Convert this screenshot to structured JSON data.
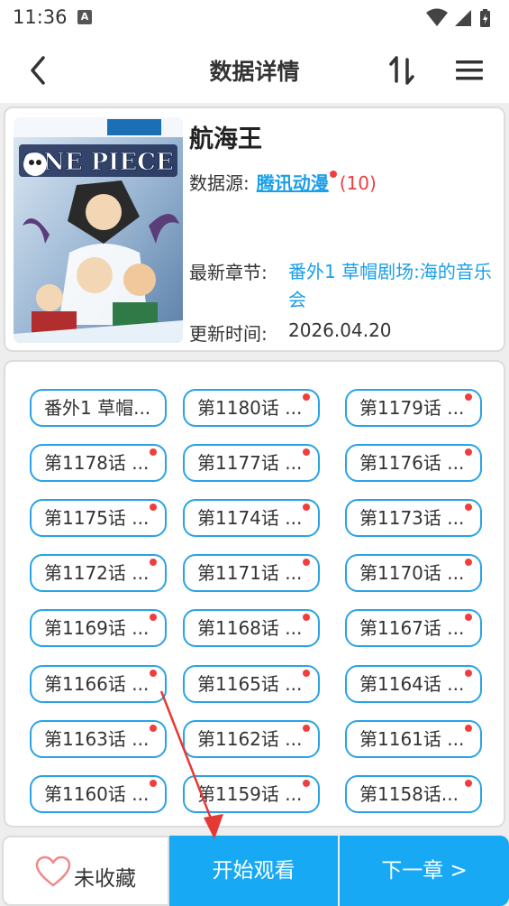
{
  "status_bar": {
    "time": "11:36",
    "notification_badge": "A",
    "icons": [
      "wifi-icon",
      "cell-signal-icon",
      "battery-icon"
    ]
  },
  "app_bar": {
    "title": "数据详情",
    "icons": [
      "back-arrow-icon",
      "sort-swap-icon",
      "menu-icon"
    ]
  },
  "comic": {
    "title": "航海王",
    "source_label": "数据源:",
    "source_name": "腾讯动漫",
    "source_count": "(10)",
    "latest_label": "最新章节:",
    "latest_value": "番外1 草帽剧场:海的音乐会",
    "update_label": "更新时间:",
    "update_value": "2026.04.20",
    "cover_art_text": "ONE PIECE"
  },
  "chapters": [
    {
      "label": "番外1 草帽...",
      "new": false
    },
    {
      "label": "第1180话 ...",
      "new": true
    },
    {
      "label": "第1179话 ...",
      "new": true
    },
    {
      "label": "第1178话 ...",
      "new": true
    },
    {
      "label": "第1177话 ...",
      "new": true
    },
    {
      "label": "第1176话 ...",
      "new": true
    },
    {
      "label": "第1175话 ...",
      "new": true
    },
    {
      "label": "第1174话 ...",
      "new": true
    },
    {
      "label": "第1173话 ...",
      "new": true
    },
    {
      "label": "第1172话 ...",
      "new": true
    },
    {
      "label": "第1171话 ...",
      "new": true
    },
    {
      "label": "第1170话 ...",
      "new": true
    },
    {
      "label": "第1169话 ...",
      "new": true
    },
    {
      "label": "第1168话 ...",
      "new": true
    },
    {
      "label": "第1167话 ...",
      "new": true
    },
    {
      "label": "第1166话 ...",
      "new": true
    },
    {
      "label": "第1165话 ...",
      "new": true
    },
    {
      "label": "第1164话 ...",
      "new": true
    },
    {
      "label": "第1163话 ...",
      "new": true
    },
    {
      "label": "第1162话 ...",
      "new": true
    },
    {
      "label": "第1161话 ...",
      "new": true
    },
    {
      "label": "第1160话 ...",
      "new": true
    },
    {
      "label": "第1159话 ...",
      "new": true
    },
    {
      "label": "第1158话...",
      "new": true
    }
  ],
  "bottom_bar": {
    "favorite_label": "未收藏",
    "start_label": "开始观看",
    "next_label": "下一章 >"
  },
  "colors": {
    "accent": "#17a9f4",
    "chip_border": "#2aa3e6",
    "new_dot": "#f03e3e",
    "link": "#1a9fe8",
    "annotation_arrow": "#e53935"
  }
}
